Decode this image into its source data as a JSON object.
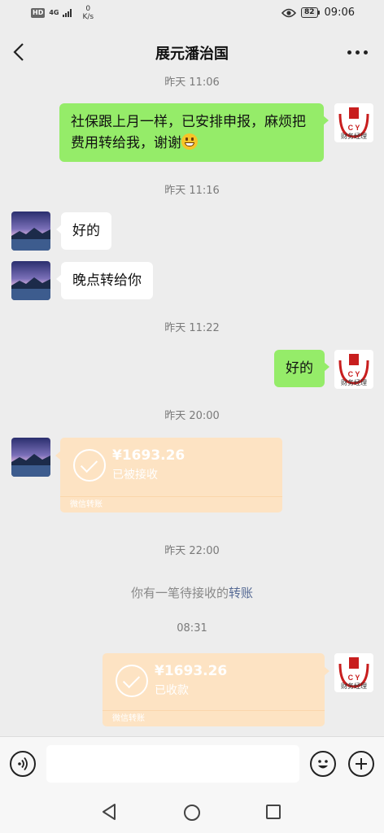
{
  "status_bar": {
    "hd": "HD",
    "network": "4G",
    "speed_value": "0",
    "speed_unit": "K/s",
    "battery": "82",
    "time": "09:06"
  },
  "header": {
    "title": "展元潘治国"
  },
  "avatar_caption": "财务经理",
  "messages": [
    {
      "type": "timestamp",
      "text": "昨天 11:06"
    },
    {
      "type": "text",
      "side": "right",
      "text": "社保跟上月一样，已安排申报，麻烦把费用转给我，谢谢",
      "emoji": "grin-emoji"
    },
    {
      "type": "timestamp",
      "text": "昨天 11:16"
    },
    {
      "type": "text",
      "side": "left",
      "text": "好的"
    },
    {
      "type": "text",
      "side": "left",
      "text": "晚点转给你"
    },
    {
      "type": "timestamp",
      "text": "昨天 11:22"
    },
    {
      "type": "text",
      "side": "right",
      "text": "好的"
    },
    {
      "type": "timestamp",
      "text": "昨天 20:00"
    },
    {
      "type": "transfer",
      "side": "left",
      "amount": "¥1693.26",
      "status": "已被接收",
      "footer": "微信转账"
    },
    {
      "type": "timestamp",
      "text": "昨天 22:00"
    },
    {
      "type": "system",
      "text": "你有一笔待接收的",
      "link": "转账"
    },
    {
      "type": "timestamp",
      "text": "08:31"
    },
    {
      "type": "transfer",
      "side": "right",
      "amount": "¥1693.26",
      "status": "已收款",
      "footer": "微信转账"
    }
  ],
  "input_bar": {
    "placeholder": ""
  },
  "colors": {
    "bubble_mine": "#95ec69",
    "bubble_other": "#ffffff",
    "transfer_done": "#fde3c3",
    "background": "#ededed",
    "link": "#576b95"
  }
}
